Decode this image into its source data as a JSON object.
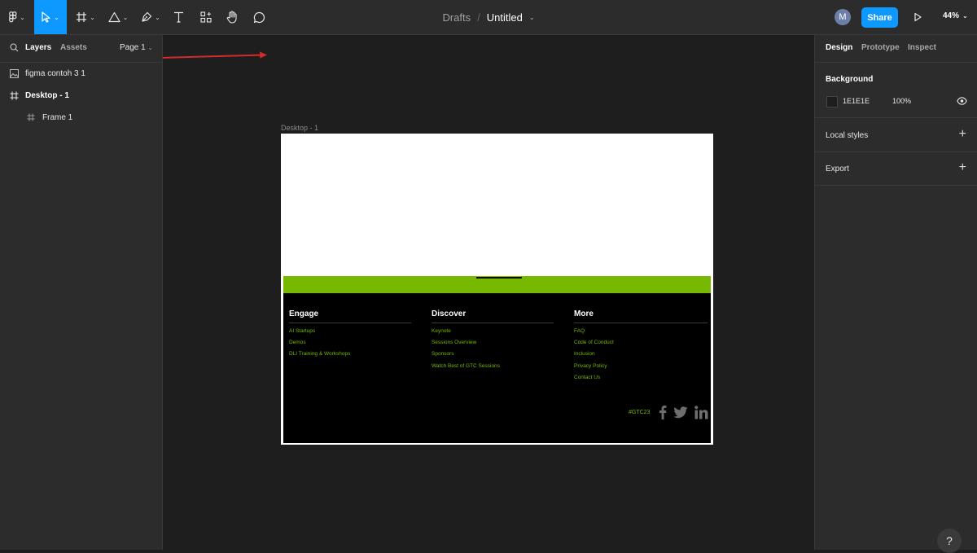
{
  "toolbar": {
    "tools": [
      {
        "name": "main-menu",
        "icon": "figma-logo-icon",
        "chevron": "⌄"
      },
      {
        "name": "move",
        "icon": "cursor-arrow-icon",
        "chevron": "⌄",
        "active": true
      },
      {
        "name": "frame",
        "icon": "hash-frame-icon",
        "chevron": "⌄"
      },
      {
        "name": "shape",
        "icon": "triangle-icon",
        "chevron": "⌄"
      },
      {
        "name": "pen",
        "icon": "pen-icon",
        "chevron": "⌄"
      },
      {
        "name": "text",
        "icon": "text-T-icon"
      },
      {
        "name": "resources",
        "icon": "resources-icon"
      },
      {
        "name": "hand",
        "icon": "hand-icon"
      },
      {
        "name": "comment",
        "icon": "comment-bubble-icon"
      }
    ],
    "breadcrumb": {
      "parent": "Drafts",
      "separator": "/",
      "title": "Untitled"
    },
    "avatar_letter": "M",
    "share_label": "Share",
    "zoom": "44%",
    "accent": "#0d99ff"
  },
  "left_panel": {
    "tabs": [
      "Layers",
      "Assets"
    ],
    "page": "Page 1",
    "layers": [
      {
        "name": "figma contoh 3 1",
        "icon": "image-icon"
      },
      {
        "name": "Desktop - 1",
        "icon": "frame-icon"
      },
      {
        "name": "Frame 1",
        "icon": "frame-icon"
      }
    ]
  },
  "right_panel": {
    "tabs": [
      "Design",
      "Prototype",
      "Inspect"
    ],
    "background": {
      "title": "Background",
      "hex": "1E1E1E",
      "opacity": "100%"
    },
    "local_styles": "Local styles",
    "export": "Export"
  },
  "canvas": {
    "frame_label": "Desktop - 1",
    "footer": {
      "columns": [
        {
          "title": "Engage",
          "links": [
            "AI Startups",
            "Demos",
            "DLI Training & Workshops"
          ]
        },
        {
          "title": "Discover",
          "links": [
            "Keynote",
            "Sessions Overview",
            "Sponsors",
            "Watch Best of GTC Sessions"
          ]
        },
        {
          "title": "More",
          "links": [
            "FAQ",
            "Code of Conduct",
            "Inclusion",
            "Privacy Policy",
            "Contact Us"
          ]
        }
      ],
      "hashtag": "#GTC23",
      "social_icons": [
        "facebook-icon",
        "twitter-icon",
        "linkedin-icon"
      ],
      "brand_green": "#76b900"
    }
  },
  "help_label": "?"
}
